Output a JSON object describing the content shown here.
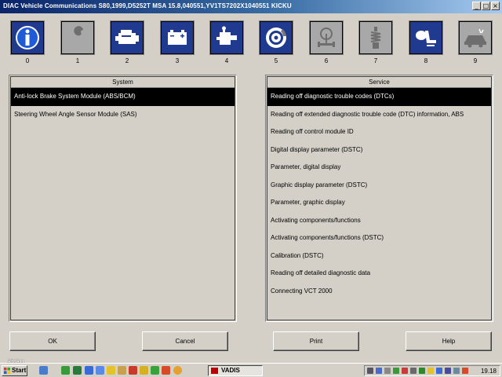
{
  "window": {
    "title": "DIAC  Vehicle Communications S80,1999,D5252T MSA 15.8,040551,YV1TS7202X1040551 KICKU",
    "minimize_glyph": "_",
    "maximize_glyph": "□",
    "close_glyph": "×"
  },
  "toolbar": {
    "items": [
      {
        "number": "0",
        "icon": "info-icon",
        "state": "active"
      },
      {
        "number": "1",
        "icon": "wrench-icon",
        "state": "inactive"
      },
      {
        "number": "2",
        "icon": "engine-icon",
        "state": "active"
      },
      {
        "number": "3",
        "icon": "battery-icon",
        "state": "active"
      },
      {
        "number": "4",
        "icon": "transmission-icon",
        "state": "active"
      },
      {
        "number": "5",
        "icon": "brake-disc-icon",
        "state": "active"
      },
      {
        "number": "6",
        "icon": "steering-icon",
        "state": "inactive"
      },
      {
        "number": "7",
        "icon": "suspension-icon",
        "state": "inactive"
      },
      {
        "number": "8",
        "icon": "seat-airbag-icon",
        "state": "active"
      },
      {
        "number": "9",
        "icon": "car-body-icon",
        "state": "inactive"
      }
    ]
  },
  "system_panel": {
    "header": "System",
    "items": [
      {
        "label": "Anti-lock Brake System Module (ABS/BCM)",
        "selected": true
      },
      {
        "label": "Steering Wheel Angle Sensor Module (SAS)",
        "selected": false
      }
    ]
  },
  "service_panel": {
    "header": "Service",
    "items": [
      {
        "label": "Reading off diagnostic trouble codes (DTCs)",
        "selected": true
      },
      {
        "label": "Reading off extended diagnostic trouble code (DTC) information, ABS",
        "selected": false
      },
      {
        "label": "Reading off control module ID",
        "selected": false
      },
      {
        "label": "Digital display parameter (DSTC)",
        "selected": false
      },
      {
        "label": "Parameter, digital display",
        "selected": false
      },
      {
        "label": "Graphic display parameter (DSTC)",
        "selected": false
      },
      {
        "label": "Parameter, graphic display",
        "selected": false
      },
      {
        "label": "Activating components/functions",
        "selected": false
      },
      {
        "label": "Activating components/functions (DSTC)",
        "selected": false
      },
      {
        "label": "Calibration (DSTC)",
        "selected": false
      },
      {
        "label": "Reading off detailed diagnostic data",
        "selected": false
      },
      {
        "label": "Connecting VCT 2000",
        "selected": false
      }
    ]
  },
  "buttons": {
    "ok": "OK",
    "cancel": "Cancel",
    "print": "Print",
    "help": "Help"
  },
  "watermark": "kicku",
  "taskbar": {
    "start_label": "Start",
    "task_label": "VADIS",
    "clock": "19.18"
  },
  "colors": {
    "active_icon_bg": "#1f3a8f",
    "inactive_icon_bg": "#a8a8a8",
    "selection_bg": "#000000",
    "window_bg": "#d4d0c8"
  }
}
